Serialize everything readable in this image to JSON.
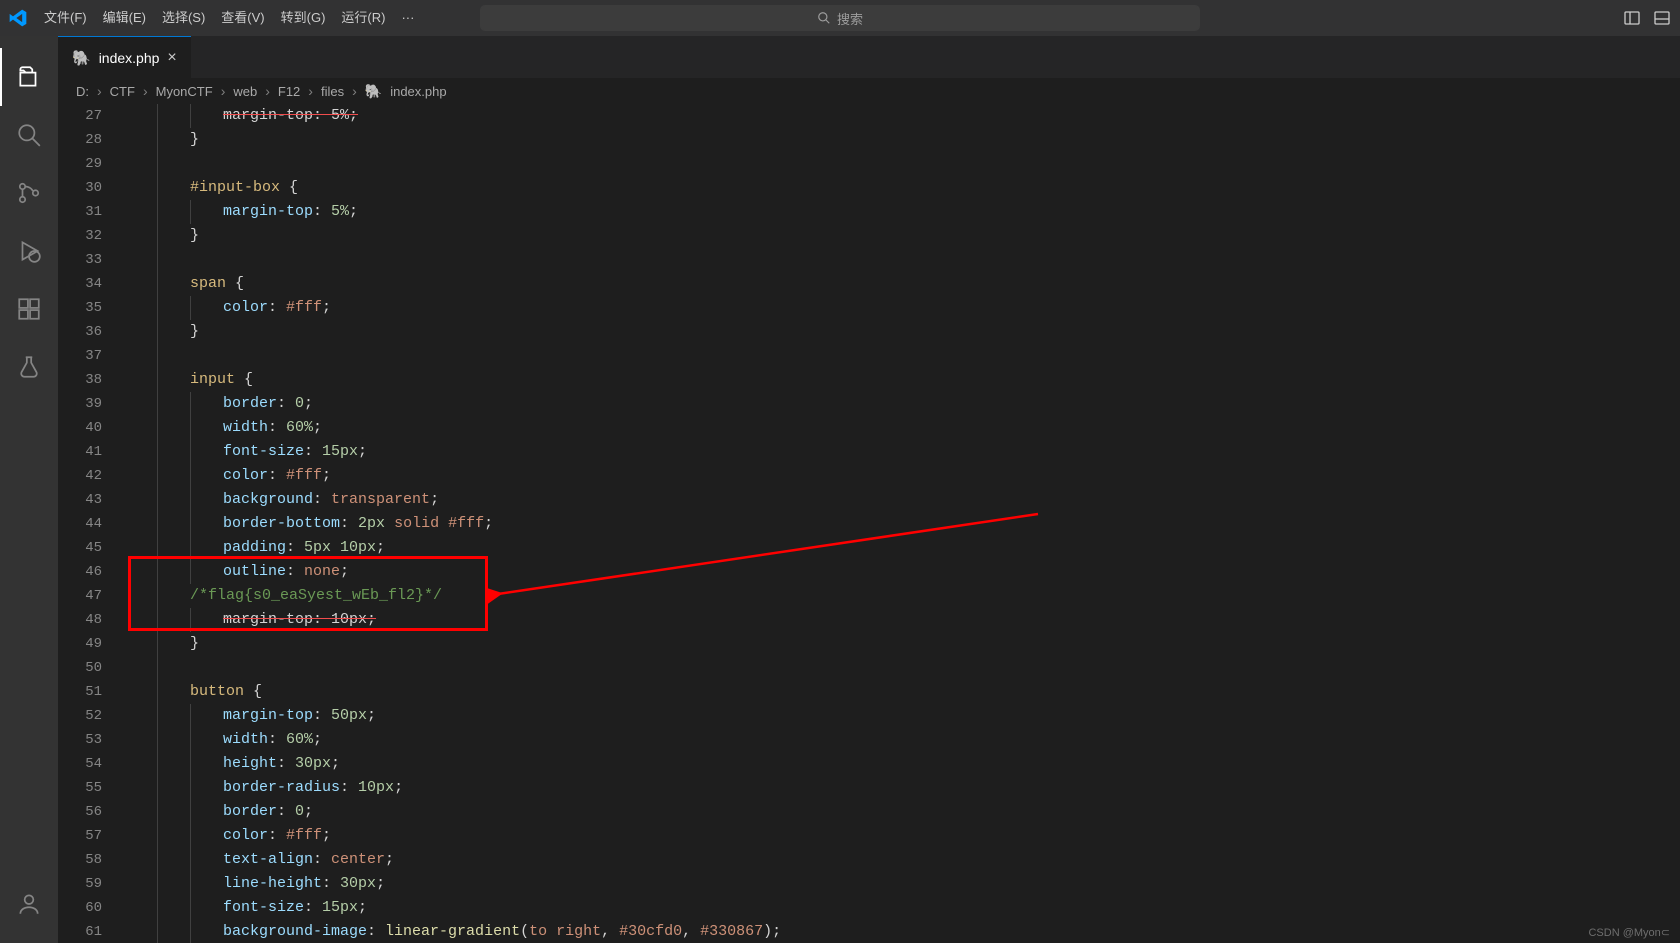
{
  "menu": {
    "file": "文件(F)",
    "edit": "编辑(E)",
    "select": "选择(S)",
    "view": "查看(V)",
    "goto": "转到(G)",
    "run": "运行(R)",
    "more": "···"
  },
  "search": {
    "placeholder": "搜索"
  },
  "tab": {
    "label": "index.php"
  },
  "breadcrumbs": {
    "parts": [
      "D:",
      "CTF",
      "MyonCTF",
      "web",
      "F12",
      "files",
      "index.php"
    ]
  },
  "gutter_start": 27,
  "code": {
    "l27": {
      "indent": 3,
      "raw_struck": "margin-top: 5%;"
    },
    "l28": {
      "indent": 2,
      "brace": "}"
    },
    "l29": {
      "blank": true
    },
    "l30": {
      "indent": 2,
      "sel": "#input-box ",
      "brace": "{"
    },
    "l31": {
      "indent": 3,
      "prop": "margin-top",
      "colon": ": ",
      "num": "5%",
      "semi": ";"
    },
    "l32": {
      "indent": 2,
      "brace": "}"
    },
    "l33": {
      "blank": true
    },
    "l34": {
      "indent": 2,
      "sel": "span ",
      "brace": "{"
    },
    "l35": {
      "indent": 3,
      "prop": "color",
      "colon": ": ",
      "val": "#fff",
      "semi": ";"
    },
    "l36": {
      "indent": 2,
      "brace": "}"
    },
    "l37": {
      "blank": true
    },
    "l38": {
      "indent": 2,
      "sel": "input ",
      "brace": "{"
    },
    "l39": {
      "indent": 3,
      "prop": "border",
      "colon": ": ",
      "num": "0",
      "semi": ";"
    },
    "l40": {
      "indent": 3,
      "prop": "width",
      "colon": ": ",
      "num": "60%",
      "semi": ";"
    },
    "l41": {
      "indent": 3,
      "prop": "font-size",
      "colon": ": ",
      "num": "15px",
      "semi": ";"
    },
    "l42": {
      "indent": 3,
      "prop": "color",
      "colon": ": ",
      "val": "#fff",
      "semi": ";"
    },
    "l43": {
      "indent": 3,
      "prop": "background",
      "colon": ": ",
      "val": "transparent",
      "semi": ";"
    },
    "l44": {
      "indent": 3,
      "prop": "border-bottom",
      "colon": ": ",
      "num": "2px ",
      "val": "solid #fff",
      "semi": ";"
    },
    "l45": {
      "indent": 3,
      "prop": "padding",
      "colon": ": ",
      "num": "5px 10px",
      "semi": ";"
    },
    "l46": {
      "indent": 3,
      "prop": "outline",
      "colon": ": ",
      "val": "none",
      "semi": ";"
    },
    "l47": {
      "comment": "/*flag{s0_eaSyest_wEb_fl2}*/"
    },
    "l48": {
      "indent": 3,
      "raw_struck": "margin-top: 10px;"
    },
    "l49": {
      "indent": 2,
      "brace": "}"
    },
    "l50": {
      "blank": true
    },
    "l51": {
      "indent": 2,
      "sel": "button ",
      "brace": "{"
    },
    "l52": {
      "indent": 3,
      "prop": "margin-top",
      "colon": ": ",
      "num": "50px",
      "semi": ";"
    },
    "l53": {
      "indent": 3,
      "prop": "width",
      "colon": ": ",
      "num": "60%",
      "semi": ";"
    },
    "l54": {
      "indent": 3,
      "prop": "height",
      "colon": ": ",
      "num": "30px",
      "semi": ";"
    },
    "l55": {
      "indent": 3,
      "prop": "border-radius",
      "colon": ": ",
      "num": "10px",
      "semi": ";"
    },
    "l56": {
      "indent": 3,
      "prop": "border",
      "colon": ": ",
      "num": "0",
      "semi": ";"
    },
    "l57": {
      "indent": 3,
      "prop": "color",
      "colon": ": ",
      "val": "#fff",
      "semi": ";"
    },
    "l58": {
      "indent": 3,
      "prop": "text-align",
      "colon": ": ",
      "val": "center",
      "semi": ";"
    },
    "l59": {
      "indent": 3,
      "prop": "line-height",
      "colon": ": ",
      "num": "30px",
      "semi": ";"
    },
    "l60": {
      "indent": 3,
      "prop": "font-size",
      "colon": ": ",
      "num": "15px",
      "semi": ";"
    },
    "l61": {
      "indent": 3,
      "prop": "background-image",
      "colon": ": ",
      "func": "linear-gradient",
      "args_kw": "to right",
      "args_sep1": ", ",
      "args_v1": "#30cfd0",
      "args_sep2": ", ",
      "args_v2": "#330867",
      "close": ");"
    }
  },
  "watermark": "CSDN @Myon⊂"
}
